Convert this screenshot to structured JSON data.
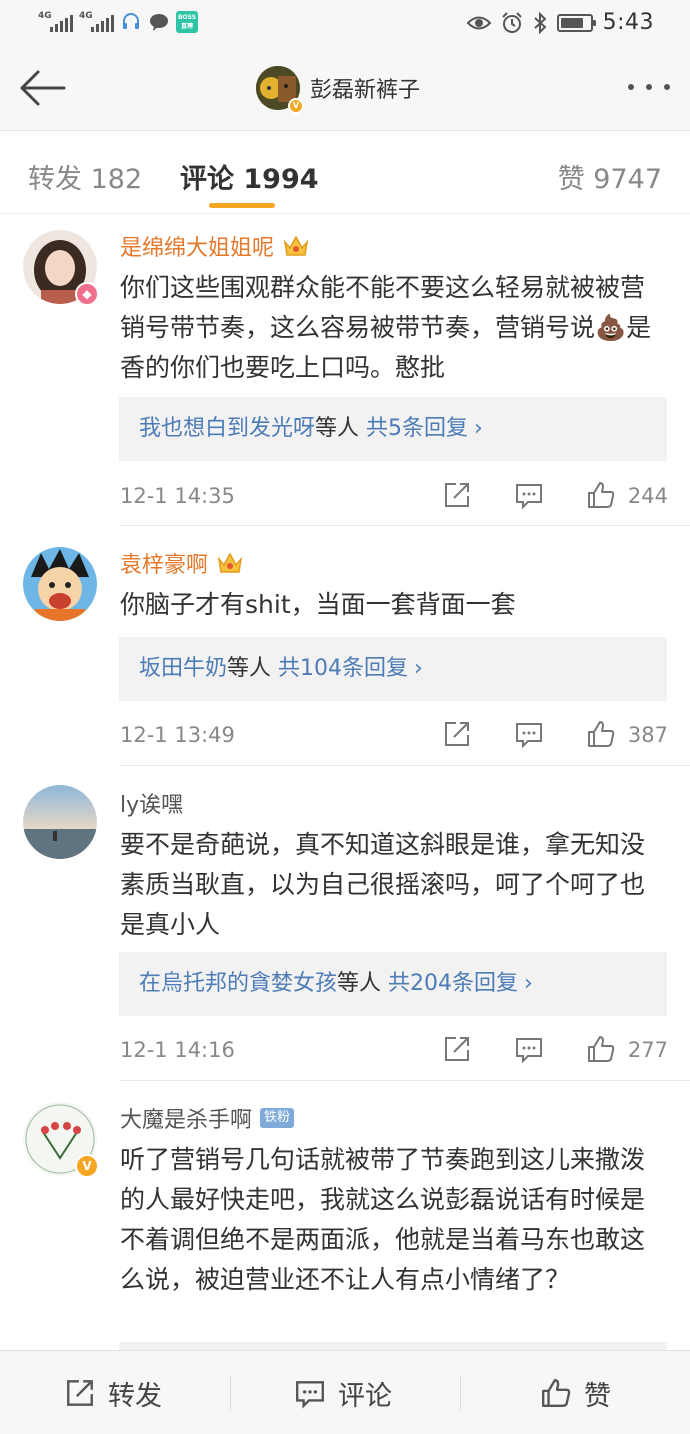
{
  "status_bar": {
    "network_1": "4G",
    "network_2": "4G",
    "time": "5:43",
    "icons": [
      "signal-icon",
      "signal-icon",
      "headset-icon",
      "chat-bubble-icon",
      "boss-app-icon",
      "eye-icon",
      "alarm-icon",
      "bluetooth-icon",
      "battery-icon"
    ]
  },
  "nav": {
    "title": "彭磊新裤子",
    "back_icon": "arrow-left-icon",
    "more_icon": "more-dots-icon"
  },
  "tabs": {
    "repost": "转发 182",
    "comment": "评论 1994",
    "like": "赞 9747",
    "active": "comment",
    "accent": "#f5a623"
  },
  "comments": [
    {
      "username": "是绵绵大姐姐呢",
      "name_color": "#e5782a",
      "text": "你们这些围观群众能不能不要这么轻易就被被营销号带节奏，这么容易被带节奏，营销号说💩是香的你们也要吃上口吗。憨批",
      "replies_who": "我也想白到发光呀",
      "replies_mid": "等人",
      "replies_count": "共5条回复",
      "time": "12-1 14:35",
      "likes": "244"
    },
    {
      "username": "袁梓豪啊",
      "name_color": "#e5782a",
      "text": "你脑子才有shit，当面一套背面一套",
      "replies_who": "坂田牛奶",
      "replies_mid": "等人",
      "replies_count": "共104条回复",
      "time": "12-1 13:49",
      "likes": "387"
    },
    {
      "username": "ly诶嘿",
      "name_color": "#555555",
      "text": "要不是奇葩说，真不知道这斜眼是谁，拿无知没素质当耿直，以为自己很摇滚吗，呵了个呵了也是真小人",
      "replies_who": "在烏托邦的貪婪女孩",
      "replies_mid": "等人",
      "replies_count": "共204条回复",
      "time": "12-1 14:16",
      "likes": "277"
    },
    {
      "username": "大魔是杀手啊",
      "fan_badge": "铁粉",
      "name_color": "#555555",
      "text": "听了营销号几句话就被带了节奏跑到这儿来撒泼的人最好快走吧，我就这么说彭磊说话有时候是不着调但绝不是两面派，他就是当着马东也敢这么说，被迫营业还不让人有点小情绪了？"
    }
  ],
  "bottom_bar": {
    "repost": "转发",
    "comment": "评论",
    "like": "赞"
  }
}
